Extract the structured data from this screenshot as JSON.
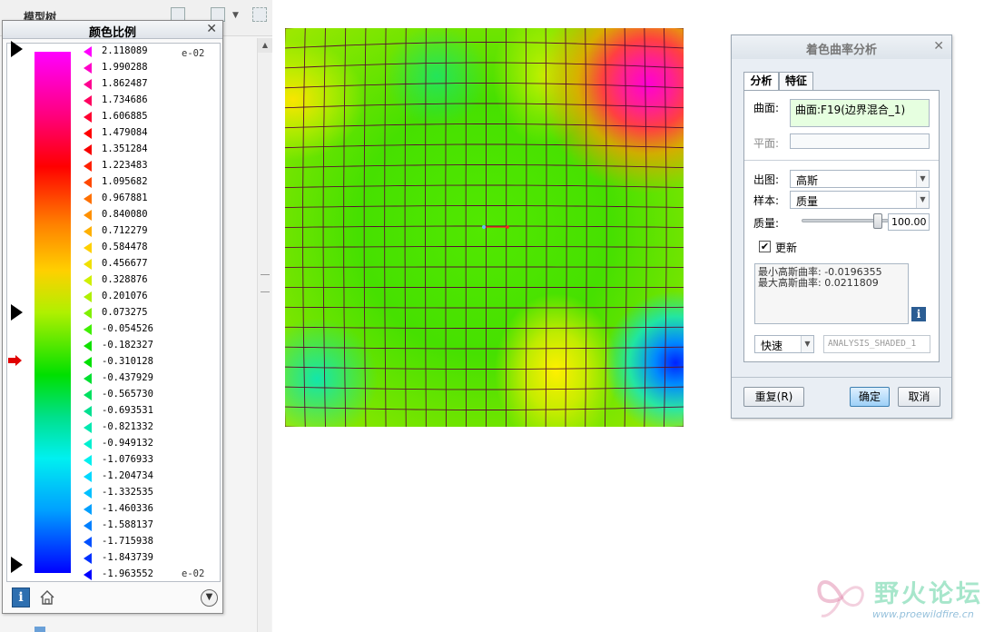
{
  "tree": {
    "title": "模型树"
  },
  "scale_panel": {
    "title": "颜色比例",
    "exponent_top": "e-02",
    "exponent_bottom": "e-02",
    "values": [
      "2.118089",
      "1.990288",
      "1.862487",
      "1.734686",
      "1.606885",
      "1.479084",
      "1.351284",
      "1.223483",
      "1.095682",
      "0.967881",
      "0.840080",
      "0.712279",
      "0.584478",
      "0.456677",
      "0.328876",
      "0.201076",
      "0.073275",
      "-0.054526",
      "-0.182327",
      "-0.310128",
      "-0.437929",
      "-0.565730",
      "-0.693531",
      "-0.821332",
      "-0.949132",
      "-1.076933",
      "-1.204734",
      "-1.332535",
      "-1.460336",
      "-1.588137",
      "-1.715938",
      "-1.843739",
      "-1.963552"
    ],
    "tick_colors": [
      "#ff00ff",
      "#ff00c8",
      "#ff0090",
      "#ff0060",
      "#ff0030",
      "#ff0000",
      "#f80000",
      "#ff2000",
      "#ff4800",
      "#ff7000",
      "#ff9000",
      "#ffb000",
      "#ffd000",
      "#f0e000",
      "#d0f000",
      "#b0f000",
      "#80f000",
      "#40f000",
      "#10e000",
      "#00e000",
      "#00e030",
      "#00e060",
      "#00e090",
      "#00e8b0",
      "#00f0d0",
      "#00f0f0",
      "#00d8ff",
      "#00c0ff",
      "#00a0ff",
      "#0080ff",
      "#0050ff",
      "#0030ff",
      "#0000ff"
    ],
    "info_label": "i"
  },
  "dialog": {
    "title": "着色曲率分析",
    "tabs": [
      "分析",
      "特征"
    ],
    "surface_label": "曲面:",
    "surface_value": "曲面:F19(边界混合_1)",
    "plane_label": "平面:",
    "plane_value": "",
    "output_label": "出图:",
    "output_value": "高斯",
    "sample_label": "样本:",
    "sample_value": "质量",
    "quality_label": "质量:",
    "quality_value": "100.00",
    "quality_level": 1.0,
    "update_label": "更新",
    "update_checked": true,
    "result_line1": "最小高斯曲率: -0.0196355",
    "result_line2": "最大高斯曲率: 0.0211809",
    "speed_value": "快速",
    "result_name": "ANALYSIS_SHADED_1",
    "info_label": "i",
    "repeat_button": "重复(R)",
    "ok_button": "确定",
    "cancel_button": "取消"
  },
  "watermark": {
    "text": "野火论坛",
    "url": "www.proewildfire.cn"
  }
}
